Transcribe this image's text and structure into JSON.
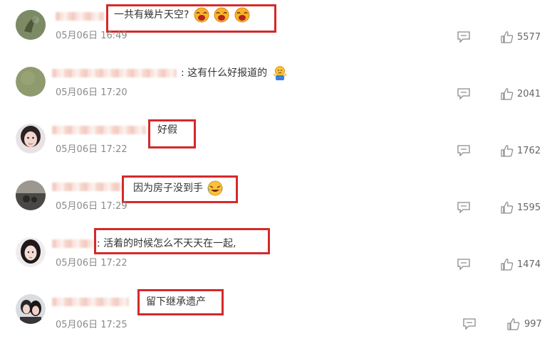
{
  "comments": [
    {
      "name": "",
      "text": "一共有幾片天空?",
      "time": "05月06日 16:49",
      "likes": "5577",
      "emojis": [
        "laugh-emoji",
        "laugh-emoji",
        "laugh-emoji"
      ]
    },
    {
      "name": "",
      "prefix": ":",
      "text": "这有什么好报道的",
      "time": "05月06日 17:20",
      "likes": "2041",
      "emojis": [
        "shrug-emoji"
      ]
    },
    {
      "name": "",
      "text": "好假",
      "time": "05月06日 17:22",
      "likes": "1762",
      "emojis": []
    },
    {
      "name": "",
      "text": "因为房子没到手",
      "time": "05月06日 17:29",
      "likes": "1595",
      "emojis": [
        "crying-laughing-emoji"
      ]
    },
    {
      "name": "",
      "prefix": ":",
      "text": "活着的时候怎么不天天在一起,",
      "time": "05月06日 17:22",
      "likes": "1474",
      "emojis": []
    },
    {
      "name": "",
      "text": "留下继承遗产",
      "time": "05月06日 17:25",
      "likes": "997",
      "emojis": []
    }
  ],
  "icons": {
    "reply": "comment-icon",
    "like": "thumbs-up-icon"
  },
  "colors": {
    "highlight": "#d32a2a",
    "text": "#333333",
    "meta": "#8a8a8a"
  }
}
